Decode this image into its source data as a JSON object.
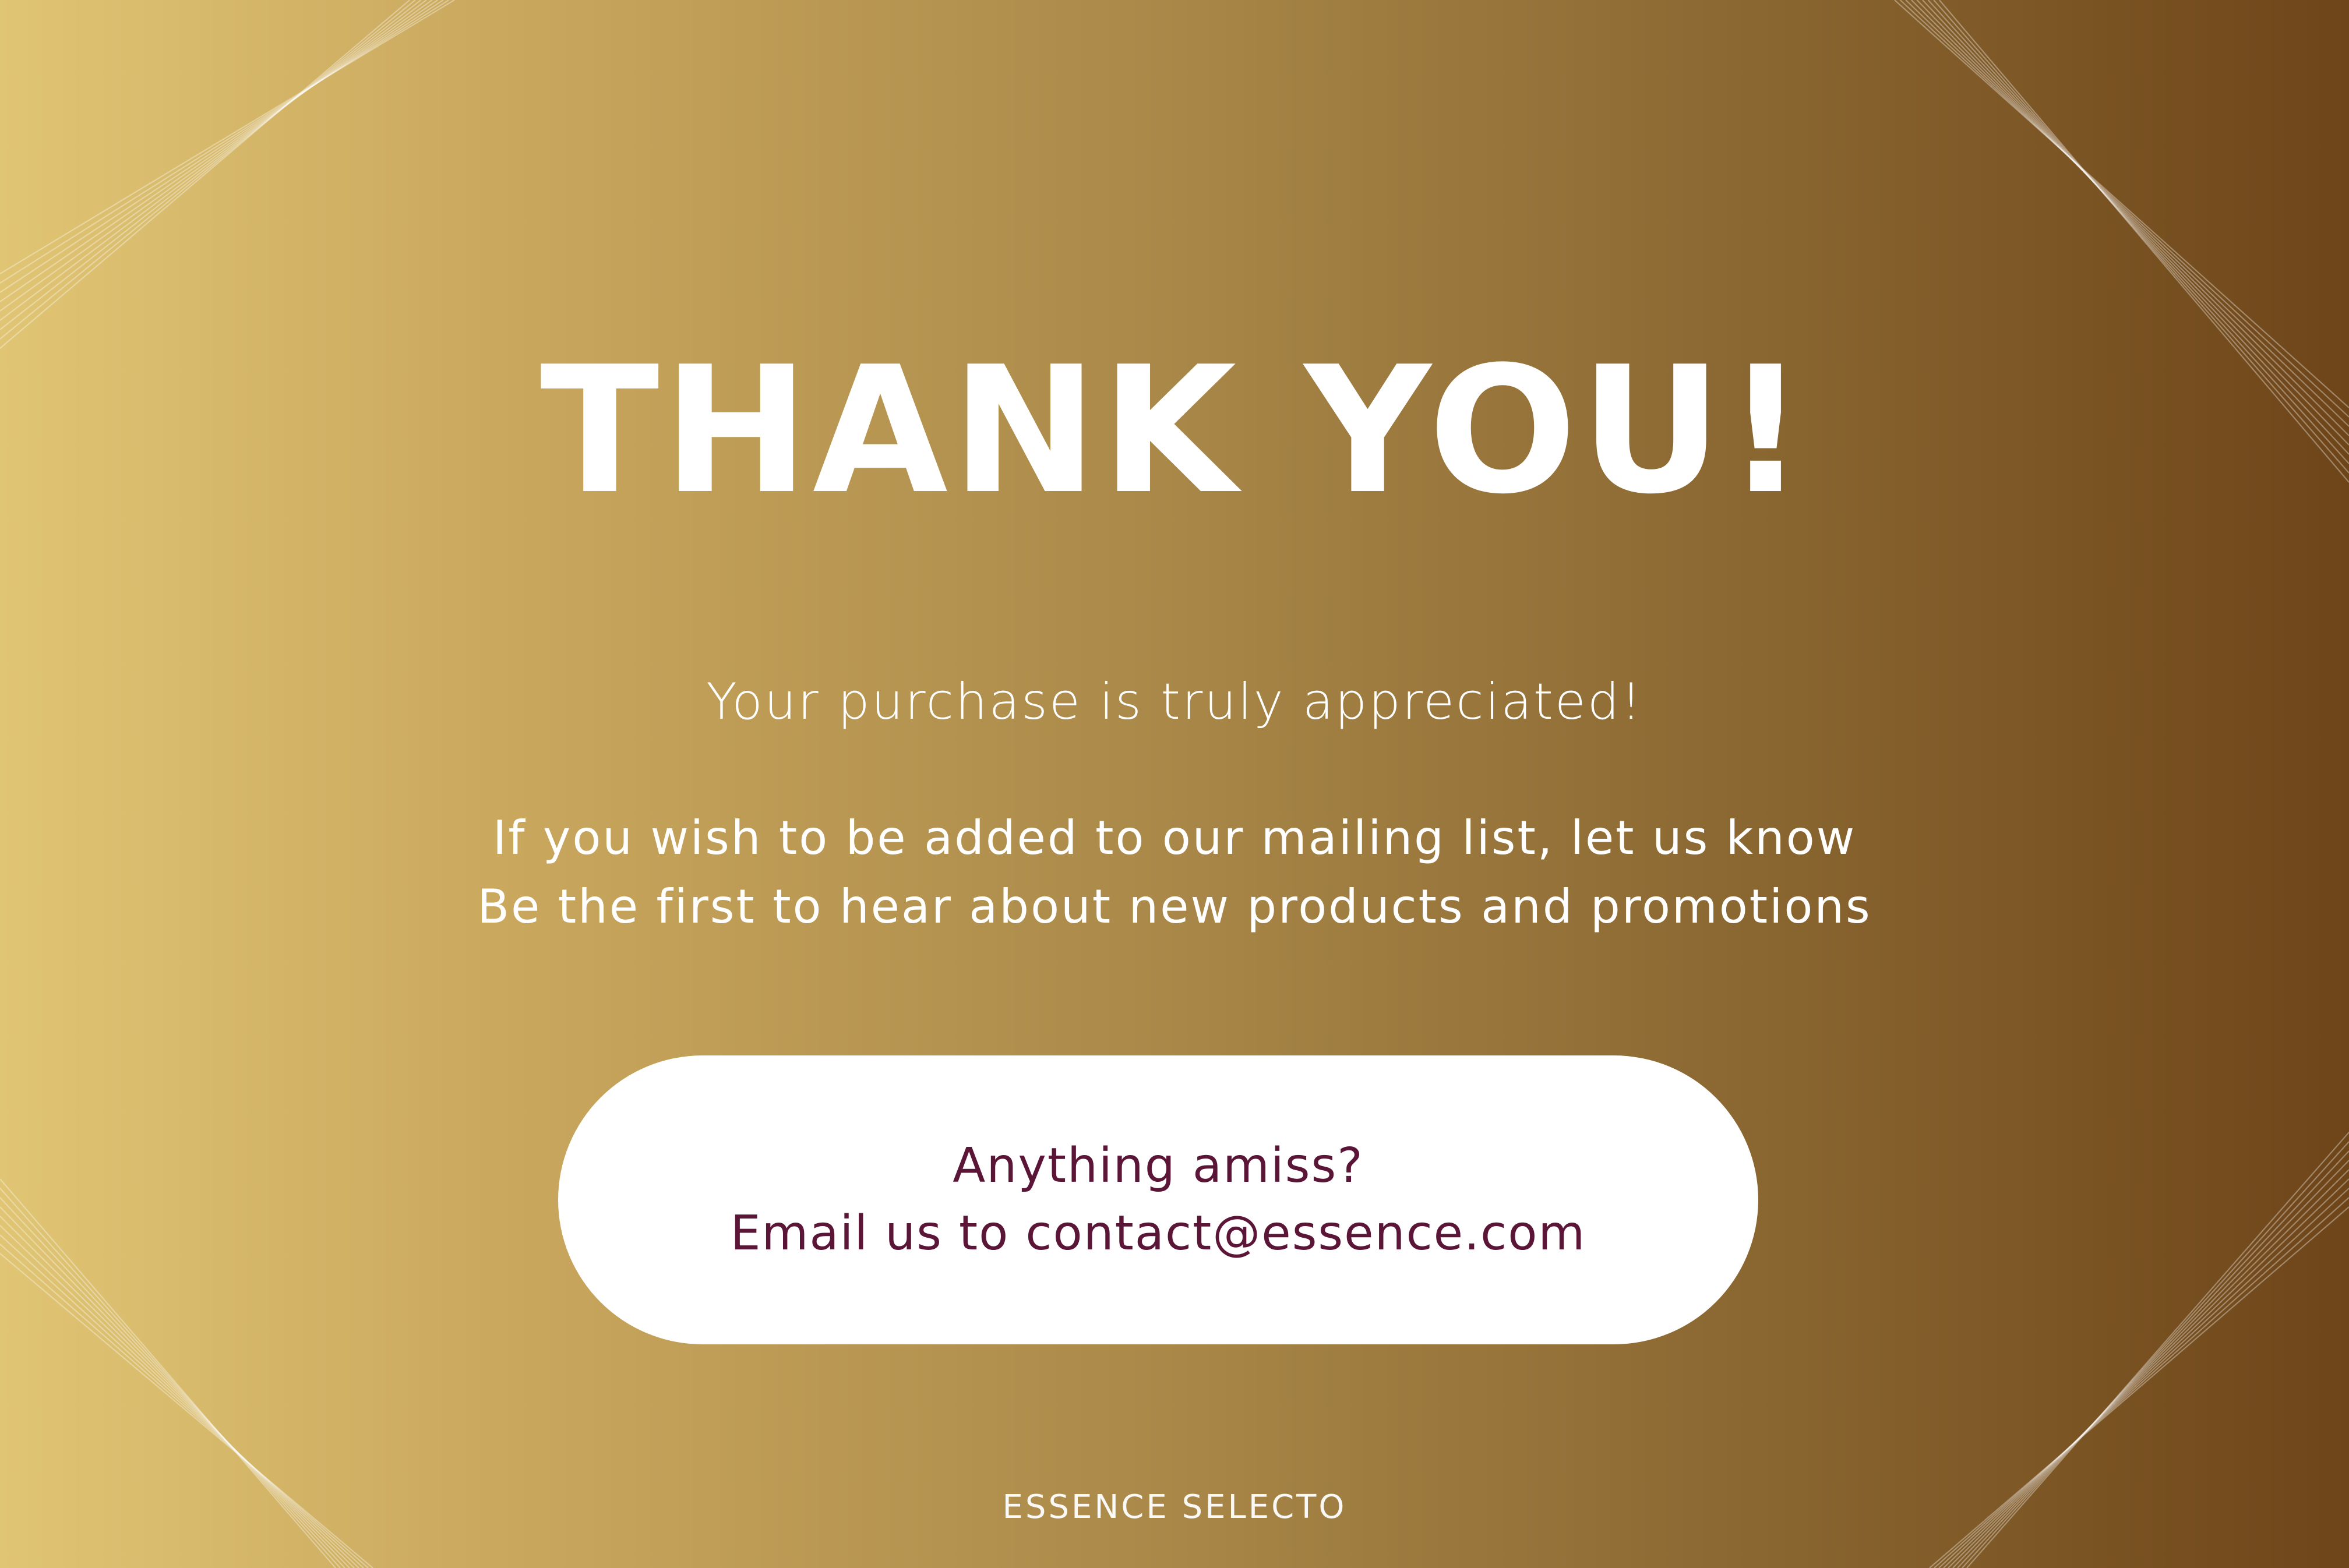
{
  "card": {
    "title": "THANK YOU!",
    "subtitle": "Your purchase is truly appreciated!",
    "mailing_line1": "If you wish to be added to our mailing list, let us know",
    "mailing_line2": "Be the first to hear about new products and promotions",
    "contact_line1": "Anything amiss?",
    "contact_line2": "Email us to contact@essence.com",
    "brand": "ESSENCE SELECTO"
  },
  "colors": {
    "gradient_left": "#e0c574",
    "gradient_right": "#6e4519",
    "title_text": "#ffffff",
    "contact_text": "#5a1537",
    "pill_background": "#ffffff"
  }
}
